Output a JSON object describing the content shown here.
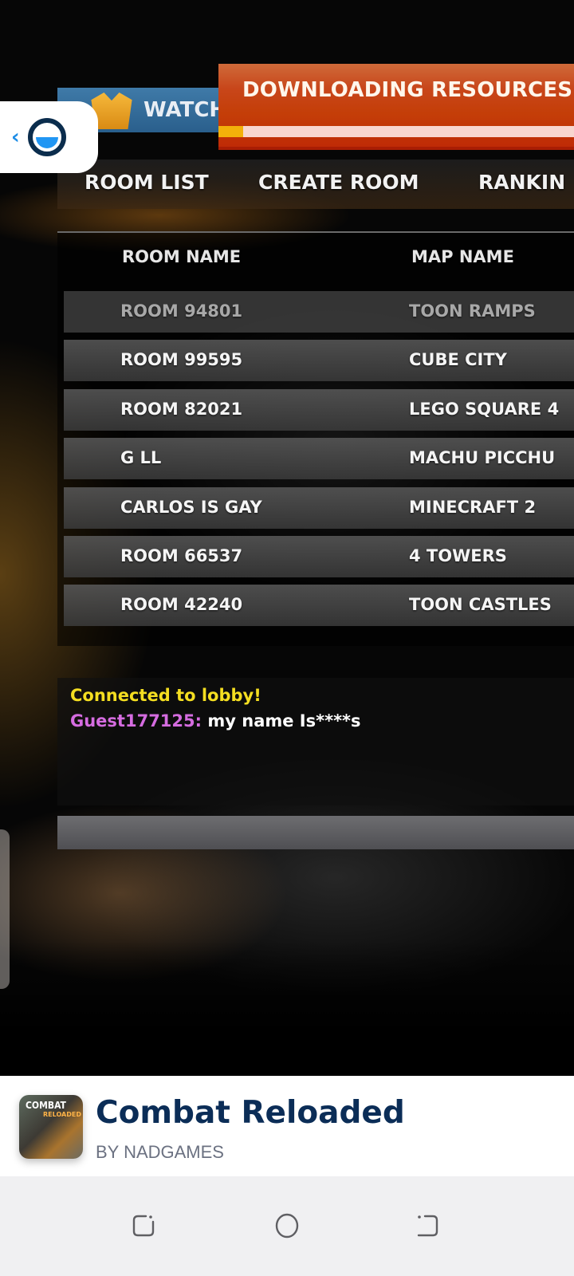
{
  "game": {
    "watch_banner_label": "WATCH",
    "download_panel": {
      "title": "DOWNLOADING RESOURCES",
      "progress_fraction": 0.07
    },
    "tabs": [
      {
        "label": "ROOM LIST"
      },
      {
        "label": "CREATE ROOM"
      },
      {
        "label": "RANKIN"
      }
    ],
    "room_list": {
      "columns": [
        "ROOM NAME",
        "MAP NAME"
      ],
      "rows": [
        {
          "room": "ROOM 94801",
          "map": "TOON RAMPS",
          "dimmed": true
        },
        {
          "room": "ROOM 99595",
          "map": "CUBE CITY"
        },
        {
          "room": "ROOM 82021",
          "map": "LEGO SQUARE 4"
        },
        {
          "room": "G LL",
          "map": "MACHU PICCHU"
        },
        {
          "room": "CARLOS IS GAY",
          "map": "MINECRAFT 2"
        },
        {
          "room": "ROOM 66537",
          "map": "4 TOWERS"
        },
        {
          "room": "ROOM 42240",
          "map": "TOON CASTLES"
        }
      ]
    },
    "chat": {
      "system_message": "Connected to lobby!",
      "messages": [
        {
          "user": "Guest177125:",
          "text": " my name Is****s"
        }
      ],
      "input_value": ""
    }
  },
  "overlay": {
    "back_icon": "chevron-left-icon",
    "logo_icon": "app-logo-icon"
  },
  "footer": {
    "app_title": "Combat Reloaded",
    "developer": "BY NADGAMES",
    "icon_text_top": "COMBAT",
    "icon_text_bottom": "RELOADED"
  },
  "navbar": {
    "buttons": [
      "recent-apps",
      "home",
      "back"
    ]
  },
  "colors": {
    "download_orange": "#c43e08",
    "progress_fill": "#f3b00a",
    "progress_track": "#f8d6cf",
    "chat_system": "#f4de21",
    "chat_user": "#d56ce0",
    "footer_title": "#0b2d57",
    "accent_blue": "#1e8de6"
  }
}
